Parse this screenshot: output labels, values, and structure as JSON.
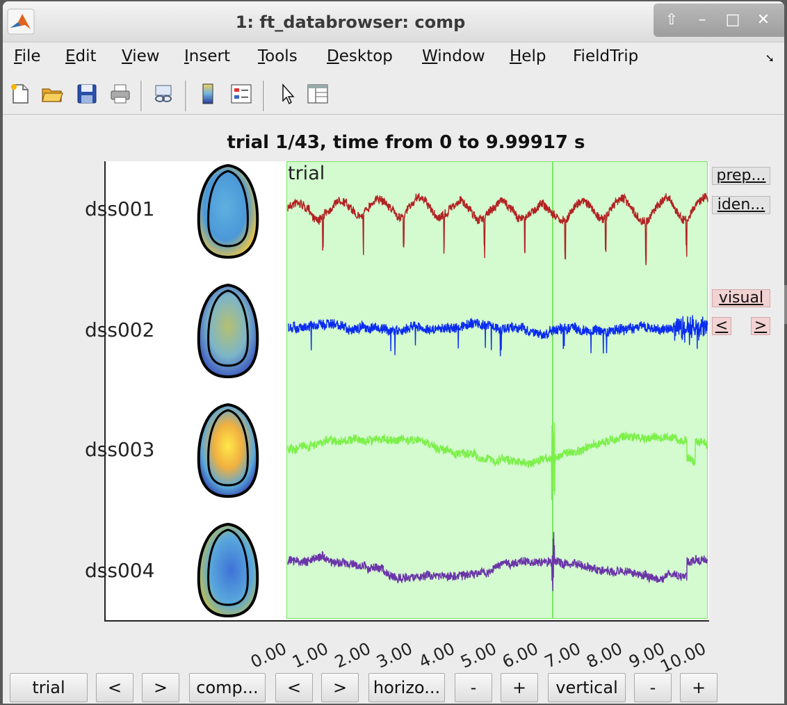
{
  "window": {
    "title": "1: ft_databrowser: comp",
    "controls": [
      "up-arrow-icon",
      "minimize-icon",
      "maximize-icon",
      "close-icon"
    ]
  },
  "menubar": {
    "items": [
      {
        "label": "File",
        "mnemonic": "F",
        "rest": "ile"
      },
      {
        "label": "Edit",
        "mnemonic": "E",
        "rest": "dit"
      },
      {
        "label": "View",
        "mnemonic": "V",
        "rest": "iew"
      },
      {
        "label": "Insert",
        "mnemonic": "I",
        "rest": "nsert"
      },
      {
        "label": "Tools",
        "mnemonic": "T",
        "rest": "ools"
      },
      {
        "label": "Desktop",
        "mnemonic": "D",
        "rest": "esktop"
      },
      {
        "label": "Window",
        "mnemonic": "W",
        "rest": "indow"
      },
      {
        "label": "Help",
        "mnemonic": "H",
        "rest": "elp"
      },
      {
        "label": "FieldTrip",
        "mnemonic": "",
        "rest": "FieldTrip"
      }
    ],
    "overflow_icon": "arrow-down-right-icon"
  },
  "toolbar": {
    "icons": [
      "new-file-icon",
      "open-folder-icon",
      "save-icon",
      "print-icon",
      "link-plot-icon",
      "colorbar-icon",
      "legend-icon",
      "pointer-icon",
      "property-inspector-icon"
    ]
  },
  "plot": {
    "title": "trial 1/43, time from 0 to 9.99917 s",
    "region_label": "trial",
    "channels": [
      {
        "label": "dss001",
        "color": "#b22222"
      },
      {
        "label": "dss002",
        "color": "#0a2cf0"
      },
      {
        "label": "dss003",
        "color": "#7cf04a"
      },
      {
        "label": "dss004",
        "color": "#6a35a8"
      }
    ],
    "marker_time": 6.32,
    "xticks": [
      "0.00",
      "1.00",
      "2.00",
      "3.00",
      "4.00",
      "5.00",
      "6.00",
      "7.00",
      "8.00",
      "9.00",
      "10.00"
    ],
    "region_color": "#d4fad0"
  },
  "side_buttons": {
    "prep": "prep...",
    "iden": "iden...",
    "visual": "visual",
    "prev": "<",
    "next": ">"
  },
  "bottom_buttons": {
    "trial": "trial",
    "trial_prev": "<",
    "trial_next": ">",
    "comp": "comp...",
    "comp_prev": "<",
    "comp_next": ">",
    "horizontal": "horizo...",
    "h_minus": "-",
    "h_plus": "+",
    "vertical": "vertical",
    "v_minus": "-",
    "v_plus": "+"
  }
}
